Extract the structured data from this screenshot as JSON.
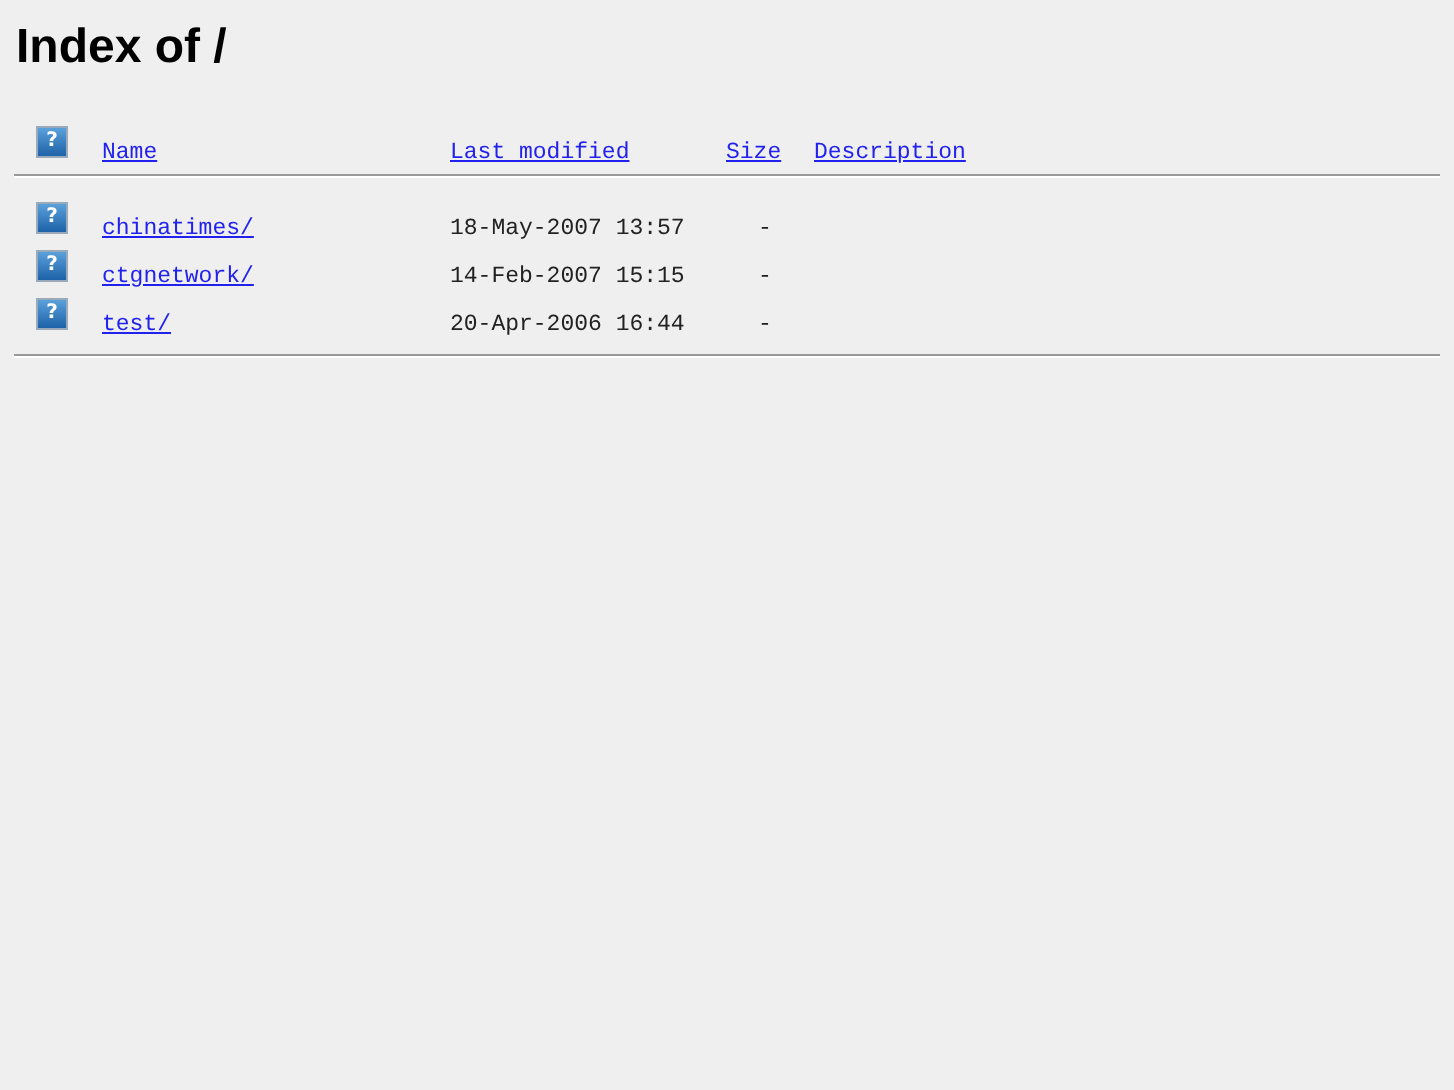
{
  "title": "Index of /",
  "header": {
    "icon": "?",
    "columns": [
      "Name",
      "Last modified",
      "Size",
      "Description"
    ]
  },
  "rows": [
    {
      "icon": "?",
      "name": "chinatimes/",
      "modified": "18-May-2007 13:57",
      "size": "-"
    },
    {
      "icon": "?",
      "name": "ctgnetwork/",
      "modified": "14-Feb-2007 15:15",
      "size": "-"
    },
    {
      "icon": "?",
      "name": "test/",
      "modified": "20-Apr-2006 16:44",
      "size": "-"
    }
  ]
}
